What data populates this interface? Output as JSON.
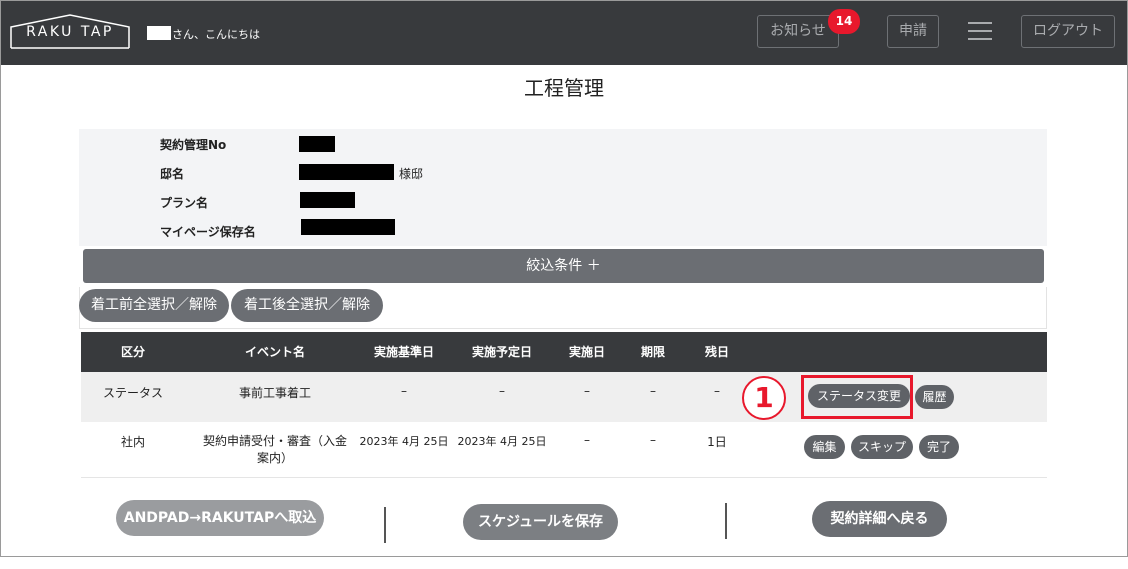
{
  "header": {
    "logo_text": "RAKU TAP",
    "greeting": "さん、こんにちは",
    "notice_label": "お知らせ",
    "notice_count": "14",
    "apply_label": "申請",
    "logout_label": "ログアウト",
    "bg_color": "#383a3d",
    "badge_color": "#e8182c"
  },
  "page": {
    "title": "工程管理"
  },
  "info": {
    "contract_no_label": "契約管理No",
    "residence_label": "邸名",
    "residence_suffix": "様邸",
    "plan_label": "プラン名",
    "mypage_label": "マイページ保存名"
  },
  "filter": {
    "label": "絞込条件 ＋"
  },
  "select_buttons": {
    "before": "着工前全選択／解除",
    "after": "着工後全選択／解除"
  },
  "table": {
    "headers": [
      "区分",
      "イベント名",
      "実施基準日",
      "実施予定日",
      "実施日",
      "期限",
      "残日"
    ],
    "rows": [
      {
        "category": "ステータス",
        "event": "事前工事着工",
        "base_date": "–",
        "scheduled_date": "–",
        "done_date": "–",
        "deadline": "–",
        "remaining": "–",
        "actions": [
          "ステータス変更",
          "履歴"
        ]
      },
      {
        "category": "社内",
        "event": "契約申請受付・審査（入金案内）",
        "base_date": "2023年 4月 25日",
        "scheduled_date": "2023年 4月 25日",
        "done_date": "–",
        "deadline": "–",
        "remaining": "1日",
        "actions": [
          "編集",
          "スキップ",
          "完了"
        ]
      }
    ]
  },
  "annotation": {
    "step_marker": "1",
    "color": "#e8182c"
  },
  "footer": {
    "import_label": "ANDPAD→RAKUTAPへ取込",
    "save_label": "スケジュールを保存",
    "back_label": "契約詳細へ戻る"
  }
}
